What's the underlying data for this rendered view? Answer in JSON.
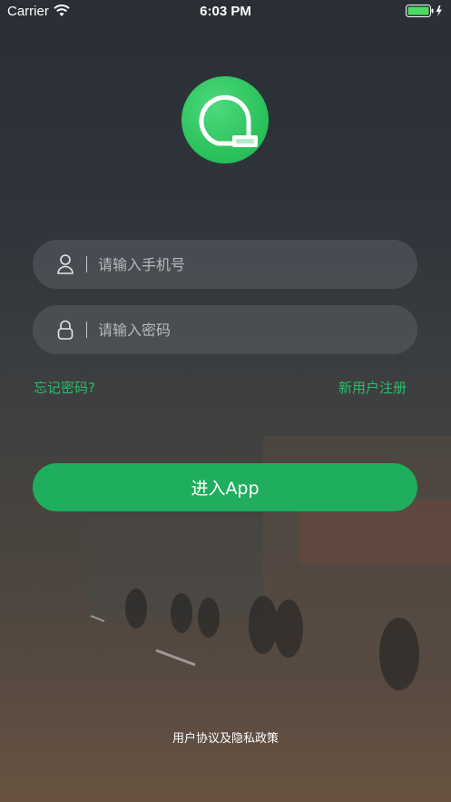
{
  "status_bar": {
    "carrier": "Carrier",
    "time": "6:03 PM",
    "wifi_icon": "wifi-icon",
    "battery_icon": "battery-charging-icon"
  },
  "logo": {
    "icon": "chat-bubble-logo-icon",
    "color": "#2cc35d"
  },
  "login_form": {
    "phone_placeholder": "请输入手机号",
    "phone_value": "",
    "phone_icon": "user-icon",
    "password_placeholder": "请输入密码",
    "password_value": "",
    "password_icon": "lock-icon"
  },
  "links": {
    "forgot_password": "忘记密码?",
    "register": "新用户注册"
  },
  "enter_button": {
    "label": "进入App",
    "color": "#1fae5d"
  },
  "footer": {
    "policy": "用户协议及隐私政策"
  },
  "colors": {
    "accent": "#27c067"
  }
}
